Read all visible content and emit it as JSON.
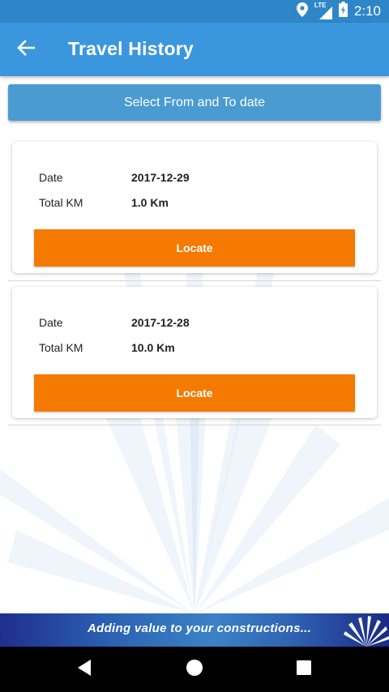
{
  "status_bar": {
    "time": "2:10",
    "network_label": "LTE",
    "icons": [
      "location-icon",
      "signal-icon",
      "battery-icon"
    ]
  },
  "app_bar": {
    "title": "Travel History",
    "back_icon": "arrow-left-icon"
  },
  "select_date_button": {
    "label": "Select From and To date"
  },
  "records": [
    {
      "date_label": "Date",
      "date": "2017-12-29",
      "km_label": "Total KM",
      "km": "1.0 Km",
      "button": "Locate"
    },
    {
      "date_label": "Date",
      "date": "2017-12-28",
      "km_label": "Total KM",
      "km": "10.0 Km",
      "button": "Locate"
    }
  ],
  "banner": {
    "tagline": "Adding value to your constructions..."
  },
  "colors": {
    "status_bar": "#2e86c8",
    "app_bar": "#3b97dd",
    "select_button": "#4a9bd2",
    "locate_button": "#f57a00",
    "nav_bar": "#000000"
  },
  "nav_bar": {
    "icons": [
      "back-triangle-icon",
      "home-circle-icon",
      "recents-square-icon"
    ]
  }
}
